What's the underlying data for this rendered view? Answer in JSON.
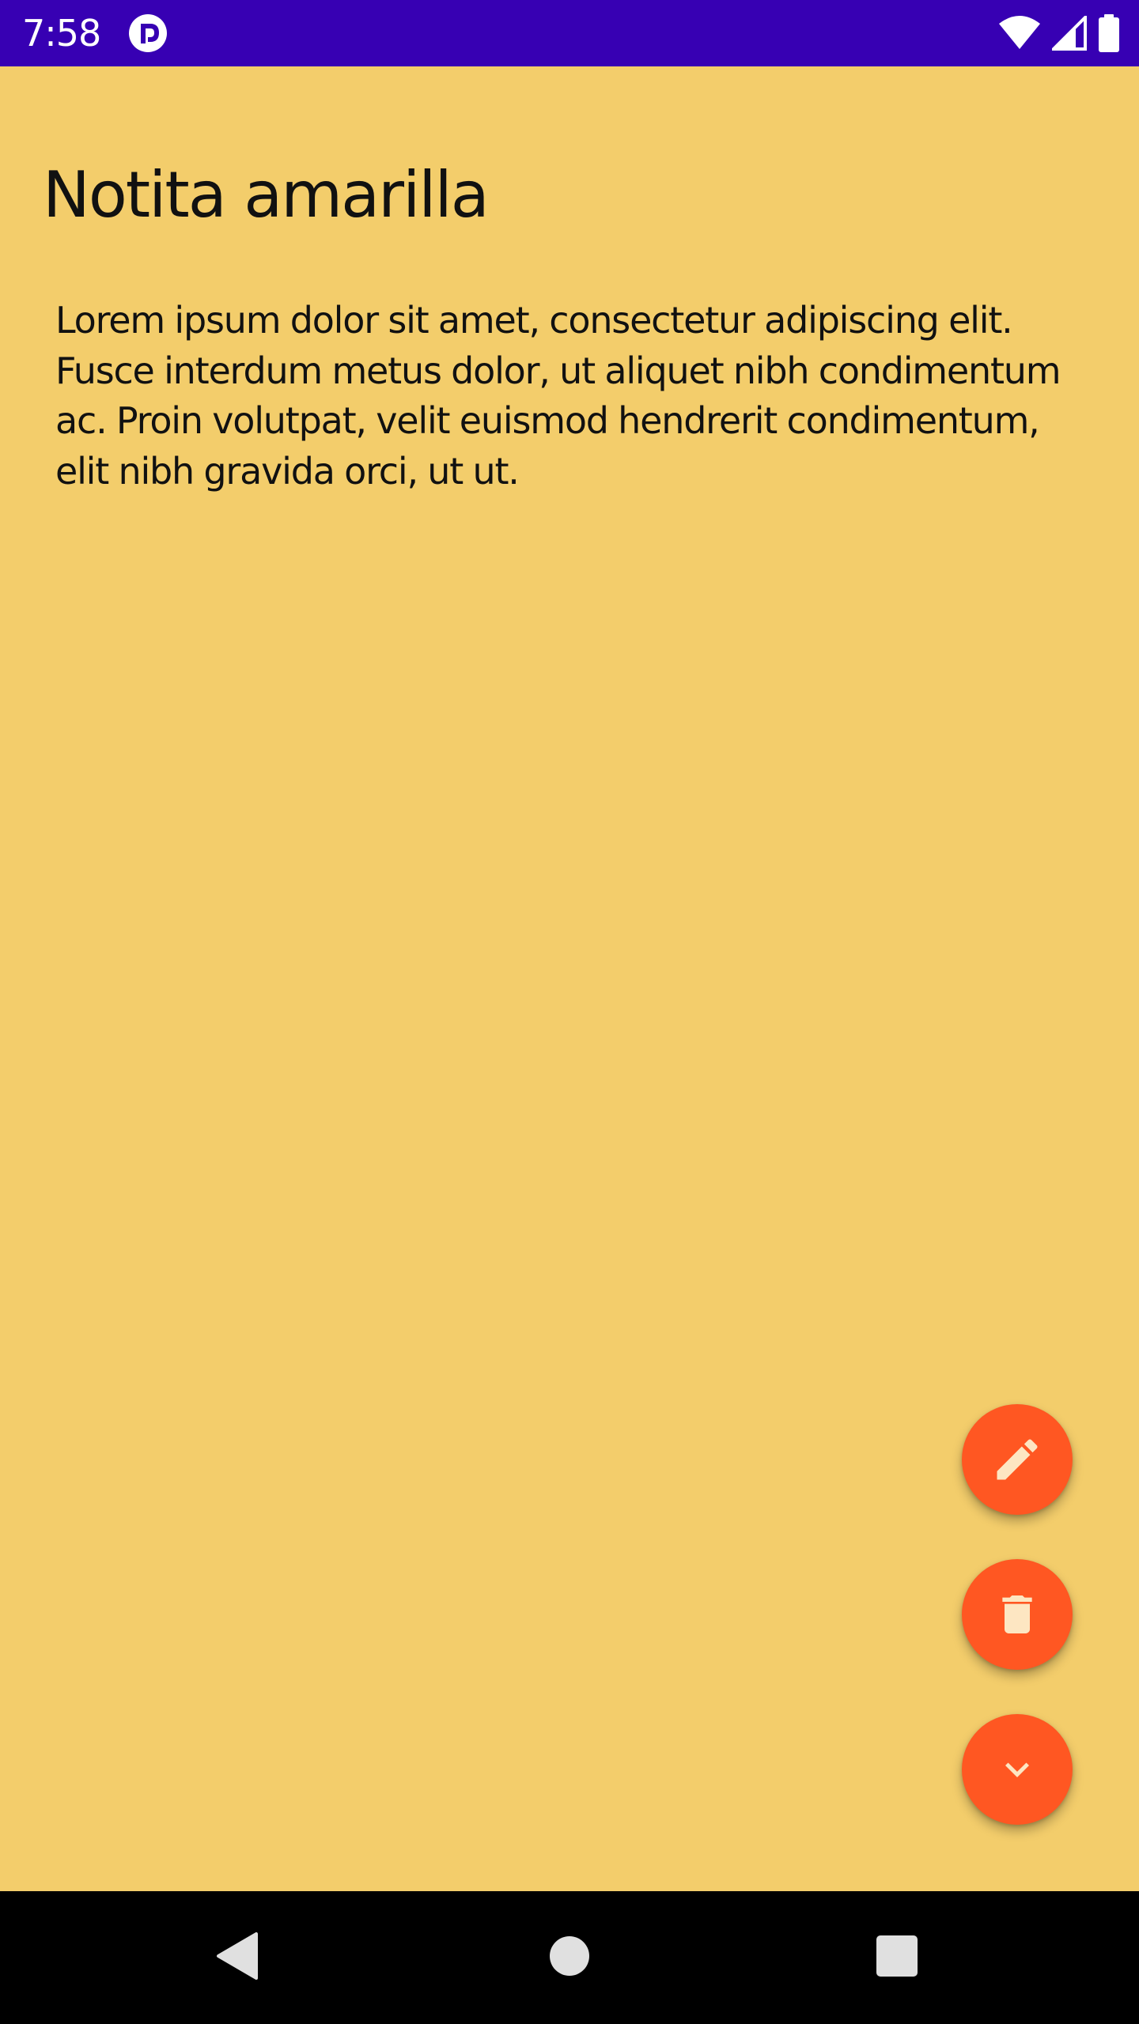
{
  "status_bar": {
    "time": "7:58",
    "background": "#3700b3",
    "icons": [
      "notification-app-icon",
      "wifi-icon",
      "cellular-signal-icon",
      "battery-icon"
    ]
  },
  "note": {
    "title": "Notita amarilla",
    "body": "Lorem ipsum dolor sit amet, consectetur adipiscing elit. Fusce interdum metus dolor, ut aliquet nibh condimentum ac. Proin volutpat, velit euismod hendrerit condimentum, elit nibh gravida orci, ut ut.",
    "background": "#f3cd6b"
  },
  "fabs": {
    "color": "#ff5722",
    "icon_color": "#fde6c2",
    "items": [
      {
        "icon": "pencil-icon"
      },
      {
        "icon": "trash-icon"
      },
      {
        "icon": "chevron-down-icon"
      }
    ]
  },
  "nav_bar": {
    "icons": [
      "back-triangle-icon",
      "home-circle-icon",
      "recents-square-icon"
    ]
  }
}
